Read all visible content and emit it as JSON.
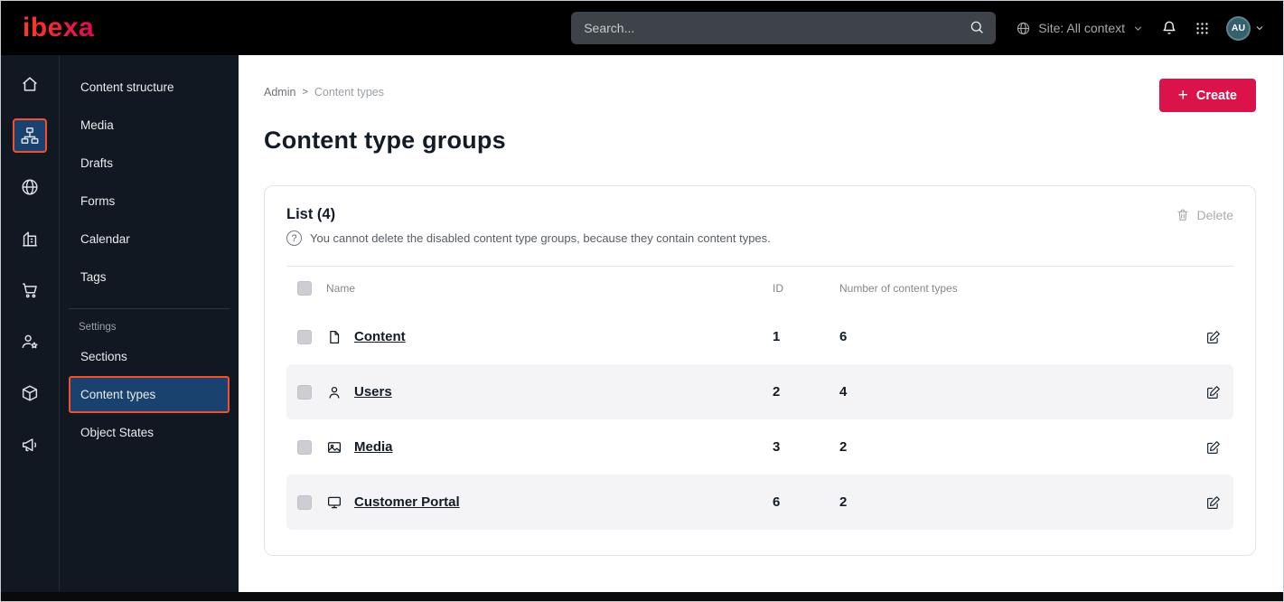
{
  "topbar": {
    "logo_text": "ibexa",
    "search_placeholder": "Search...",
    "site_context_label": "Site: All context",
    "avatar_initials": "AU"
  },
  "rail": {
    "items": [
      {
        "icon": "home-icon",
        "active": false
      },
      {
        "icon": "content-tree-icon",
        "active": true
      },
      {
        "icon": "globe-icon",
        "active": false
      },
      {
        "icon": "building-icon",
        "active": false
      },
      {
        "icon": "cart-icon",
        "active": false
      },
      {
        "icon": "customers-icon",
        "active": false
      },
      {
        "icon": "product-box-icon",
        "active": false
      },
      {
        "icon": "megaphone-icon",
        "active": false
      }
    ]
  },
  "menu": {
    "items": [
      "Content structure",
      "Media",
      "Drafts",
      "Forms",
      "Calendar",
      "Tags"
    ],
    "settings_label": "Settings",
    "settings_items": [
      {
        "label": "Sections",
        "active": false
      },
      {
        "label": "Content types",
        "active": true
      },
      {
        "label": "Object States",
        "active": false
      }
    ]
  },
  "main": {
    "breadcrumb": {
      "items": [
        "Admin",
        "Content types"
      ],
      "separator": ">"
    },
    "create_button": {
      "label": "Create",
      "plus_glyph": "+"
    },
    "page_title": "Content type groups",
    "list": {
      "title": "List (4)",
      "help_glyph": "?",
      "info": "You cannot delete the disabled content type groups, because they contain content types.",
      "delete_label": "Delete",
      "headers": {
        "name": "Name",
        "id": "ID",
        "count": "Number of content types"
      },
      "rows": [
        {
          "icon": "file-icon",
          "name": "Content",
          "id": "1",
          "count": "6"
        },
        {
          "icon": "user-icon",
          "name": "Users",
          "id": "2",
          "count": "4"
        },
        {
          "icon": "image-icon",
          "name": "Media",
          "id": "3",
          "count": "2"
        },
        {
          "icon": "monitor-icon",
          "name": "Customer Portal",
          "id": "6",
          "count": "2"
        }
      ]
    }
  },
  "colors": {
    "accent": "#db134b",
    "active_bg": "#19436e",
    "active_border": "#f4502e",
    "nav_dark": "#121822",
    "heading": "#131c26",
    "stripe": "#f4f4f6"
  }
}
